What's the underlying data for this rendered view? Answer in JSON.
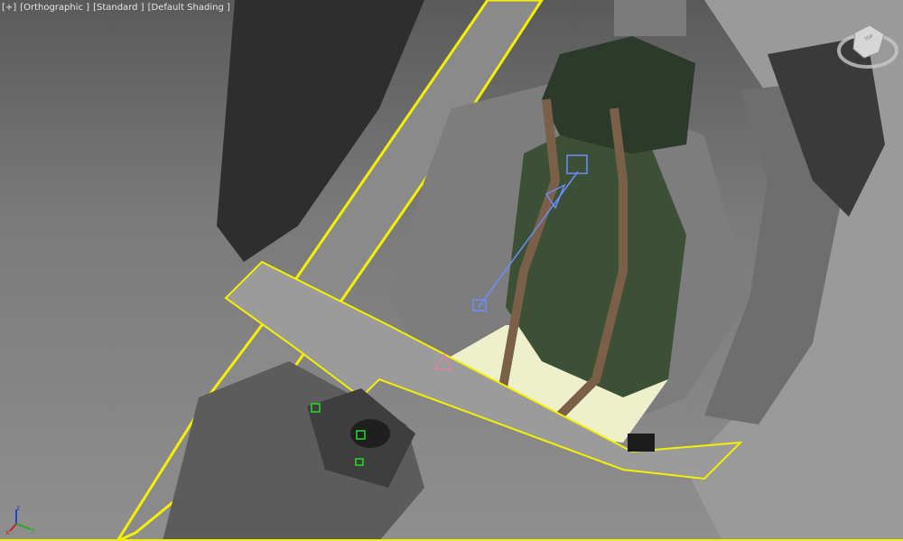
{
  "viewport": {
    "labels": {
      "menu": "[+]",
      "view": "[Orthographic ]",
      "mode": "[Standard ]",
      "shading": "[Default Shading ]"
    },
    "viewcube_face": "TOP",
    "axis": {
      "x": "x",
      "y": "y",
      "z": "z"
    },
    "colors": {
      "selection": "#f5f000",
      "helper_blue": "#6d8cff",
      "helper_green": "#22dd22",
      "helper_pink": "#ff77aa"
    }
  }
}
